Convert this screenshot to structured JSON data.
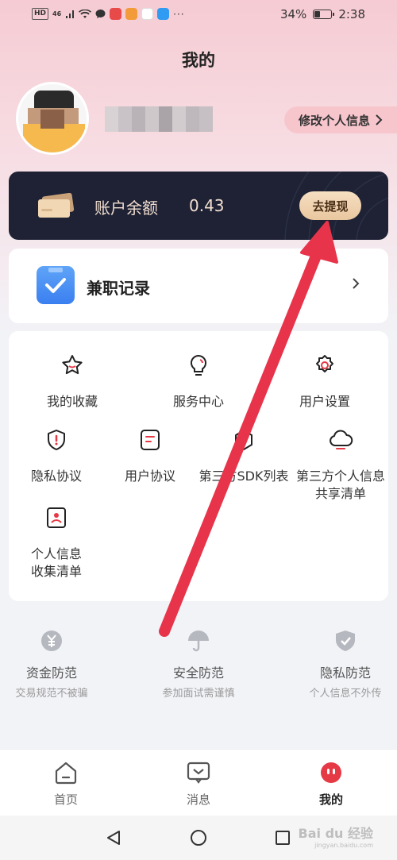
{
  "status_bar": {
    "left_chip": "HD",
    "network": "46",
    "battery": "34%",
    "battery_level": 0.34,
    "time": "2:38"
  },
  "page": {
    "title": "我的"
  },
  "profile": {
    "edit_label": "修改个人信息",
    "edit_icon": "chevron-right-icon"
  },
  "balance": {
    "label": "账户余额",
    "value": "0.43",
    "withdraw_label": "去提现",
    "icon": "wallet-card-icon"
  },
  "part_time": {
    "label": "兼职记录",
    "icon": "checklist-icon"
  },
  "menu": {
    "items": [
      {
        "label": "我的收藏",
        "icon": "star-icon"
      },
      {
        "label": "服务中心",
        "icon": "lightbulb-icon"
      },
      {
        "label": "用户设置",
        "icon": "gear-icon"
      },
      {
        "label": "隐私协议",
        "icon": "shield-icon"
      },
      {
        "label": "用户协议",
        "icon": "document-icon"
      },
      {
        "label": "第三方SDK列表",
        "icon": "cube-icon"
      },
      {
        "label": "第三方个人信息",
        "label2": "共享清单",
        "icon": "cloud-icon"
      },
      {
        "label": "个人信息",
        "label2": "收集清单",
        "icon": "id-card-icon"
      }
    ]
  },
  "guarantees": [
    {
      "title": "资金防范",
      "subtitle": "交易规范不被骗",
      "icon": "yuan-coin-icon"
    },
    {
      "title": "安全防范",
      "subtitle": "参加面试需谨慎",
      "icon": "umbrella-icon"
    },
    {
      "title": "隐私防范",
      "subtitle": "个人信息不外传",
      "icon": "shield-check-icon"
    }
  ],
  "bottom_nav": [
    {
      "label": "首页",
      "icon": "home-icon",
      "active": false
    },
    {
      "label": "消息",
      "icon": "message-icon",
      "active": false
    },
    {
      "label": "我的",
      "icon": "profile-icon",
      "active": true
    }
  ],
  "watermark": {
    "text": "Bai du 经验",
    "sub": "jingyan.baidu.com"
  },
  "colors": {
    "accent_red": "#e63946",
    "card_dark": "#1e2234",
    "gold": "#e9c79f",
    "pink_header": "#f6cbd3"
  }
}
